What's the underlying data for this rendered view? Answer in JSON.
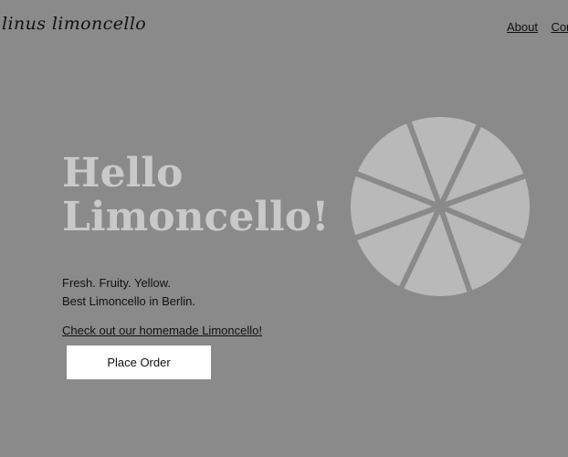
{
  "header": {
    "logo_text": "linus limoncello",
    "nav": [
      "About",
      "Cont"
    ]
  },
  "hero": {
    "title_line1": "Hello",
    "title_line2": "Limoncello!",
    "tagline_line1": "Fresh. Fruity. Yellow.",
    "tagline_line2": "Best Limoncello in Berlin.",
    "cta_link": "Check out our homemade Limoncello!",
    "order_button": "Place Order"
  },
  "colors": {
    "background": "#8a8a8a",
    "title": "#c9c9c9",
    "button_bg": "#ffffff",
    "lemon_fill": "#b9b9b9"
  },
  "icons": {
    "illustration": "lemon-slice-icon"
  }
}
